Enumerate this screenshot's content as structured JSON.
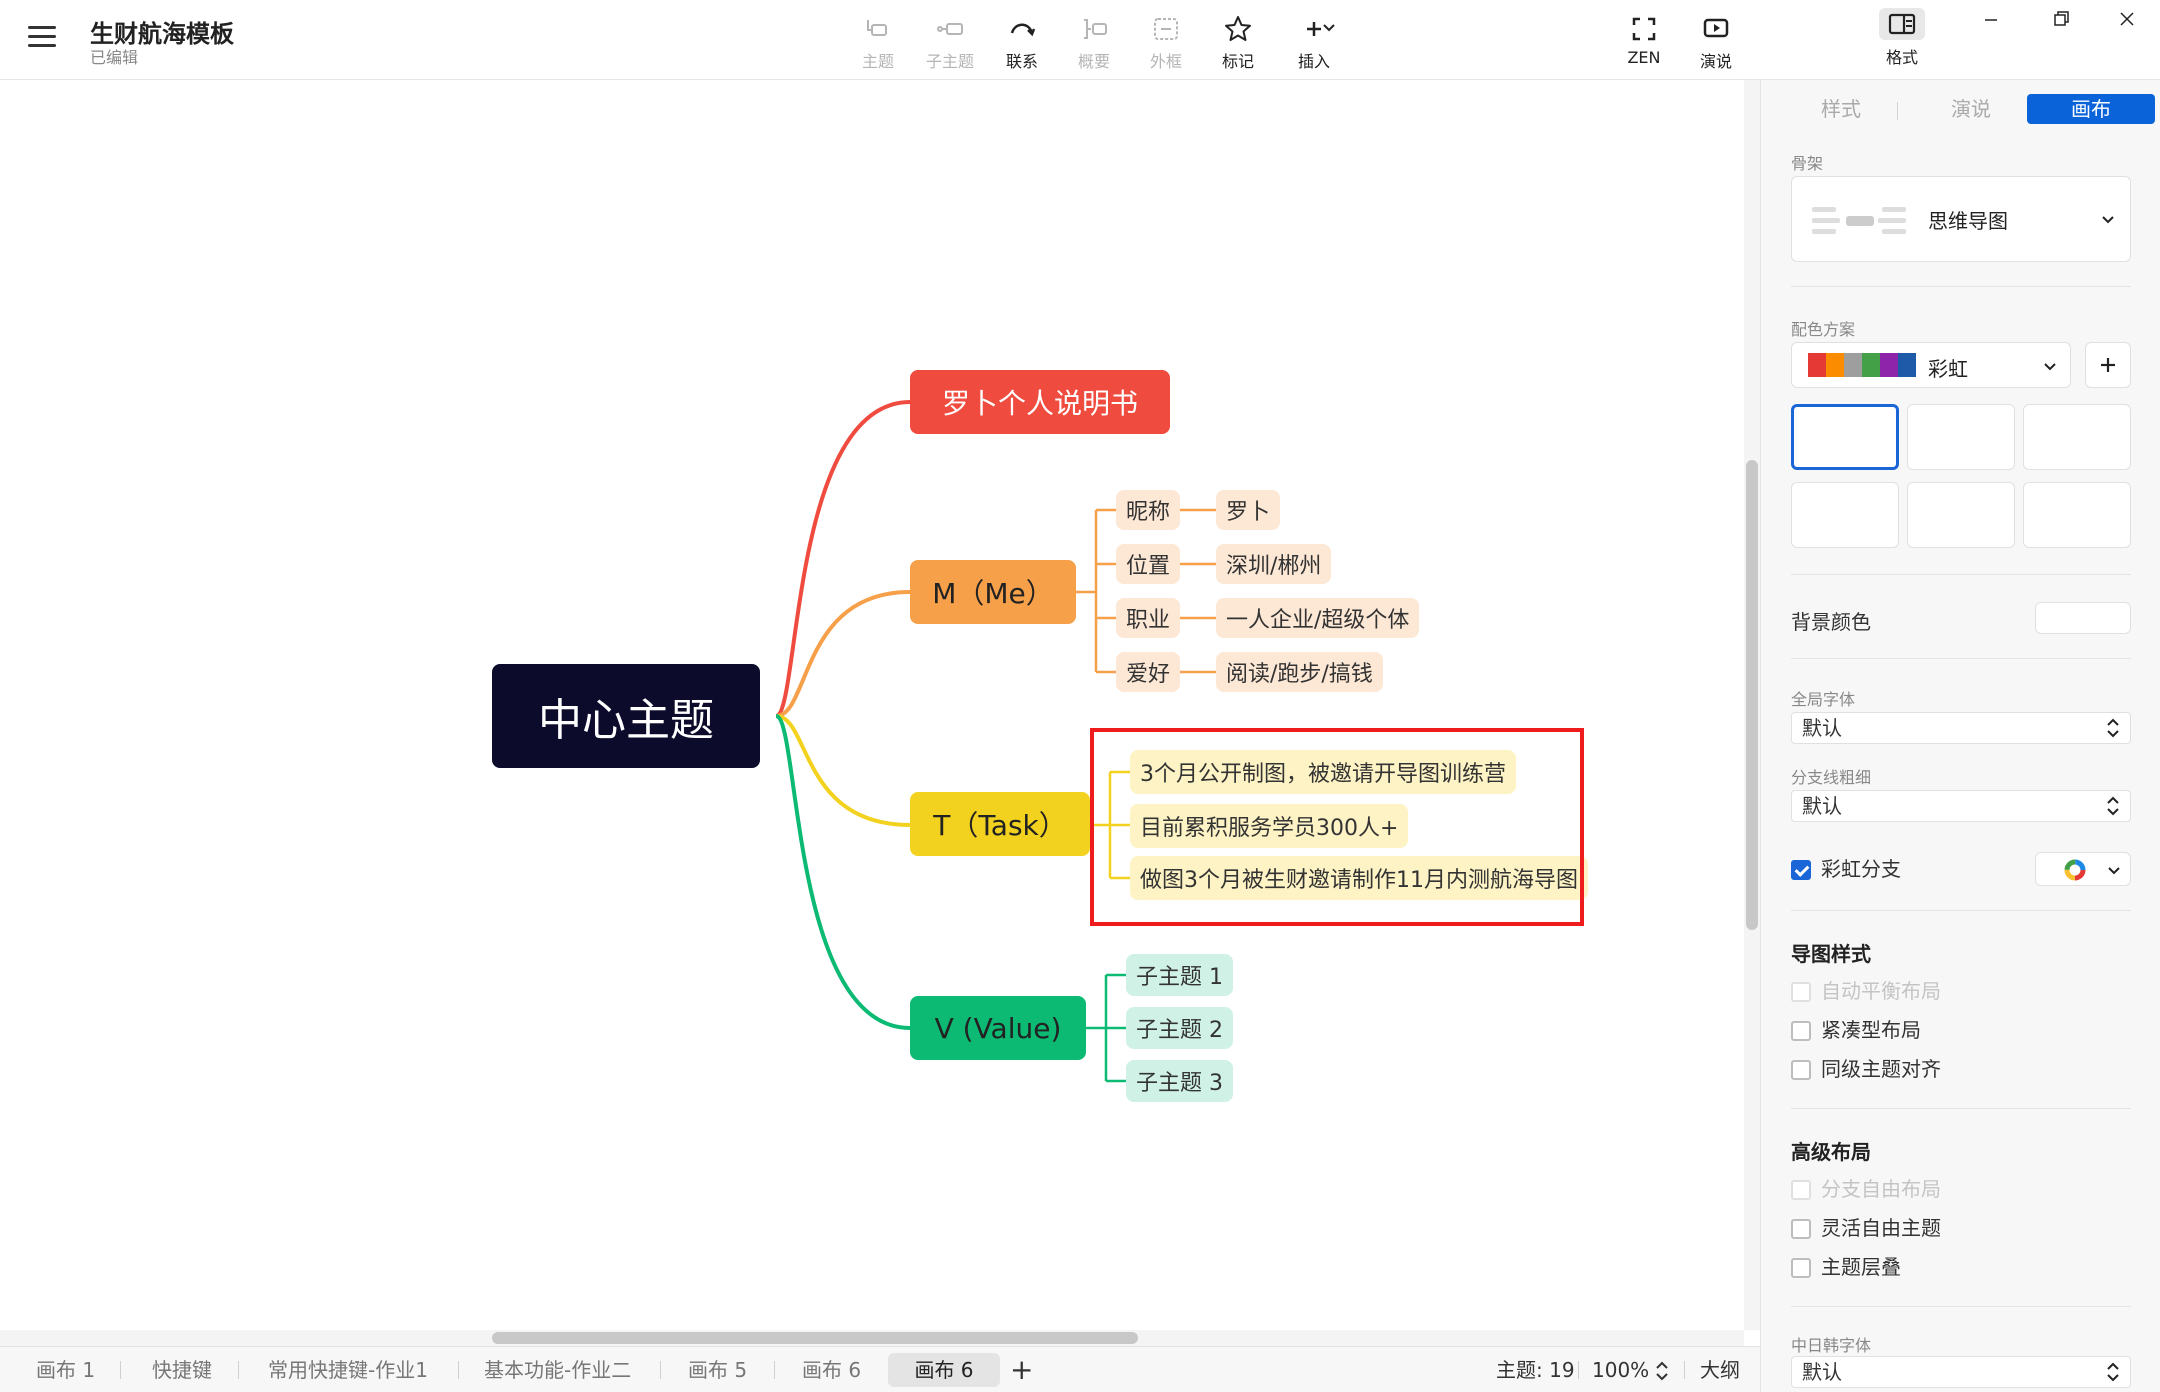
{
  "header": {
    "title": "生财航海模板",
    "status": "已编辑",
    "tools": [
      {
        "label": "主题",
        "icon": "topic-icon",
        "disabled": true
      },
      {
        "label": "子主题",
        "icon": "subtopic-icon",
        "disabled": true
      },
      {
        "label": "联系",
        "icon": "relationship-icon",
        "disabled": false
      },
      {
        "label": "概要",
        "icon": "summary-icon",
        "disabled": true
      },
      {
        "label": "外框",
        "icon": "boundary-icon",
        "disabled": true
      },
      {
        "label": "标记",
        "icon": "star-icon",
        "disabled": false
      },
      {
        "label": "插入",
        "icon": "plus-icon",
        "disabled": false
      }
    ],
    "right_tools": [
      {
        "label": "ZEN",
        "icon": "fullscreen-icon"
      },
      {
        "label": "演说",
        "icon": "present-icon"
      }
    ],
    "format_label": "格式"
  },
  "mindmap": {
    "central": "中心主题",
    "branches": [
      {
        "label": "罗卜个人说明书",
        "color": "#f04b3f",
        "children": []
      },
      {
        "label": "M（Me）",
        "color": "#f7a04a",
        "children": [
          {
            "label": "昵称",
            "value": "罗卜"
          },
          {
            "label": "位置",
            "value": "深圳/郴州"
          },
          {
            "label": "职业",
            "value": "一人企业/超级个体"
          },
          {
            "label": "爱好",
            "value": "阅读/跑步/搞钱"
          }
        ]
      },
      {
        "label": "T（Task）",
        "color": "#f2d21e",
        "children": [
          {
            "label": "3个月公开制图，被邀请开导图训练营"
          },
          {
            "label": "目前累积服务学员300人+"
          },
          {
            "label": "做图3个月被生财邀请制作11月内测航海导图"
          }
        ]
      },
      {
        "label": "V (Value)",
        "color": "#0cba74",
        "children": [
          {
            "label": "子主题 1"
          },
          {
            "label": "子主题 2"
          },
          {
            "label": "子主题 3"
          }
        ]
      }
    ],
    "highlight_color": "#ee1c1c"
  },
  "bottom": {
    "tabs": [
      "画布 1",
      "快捷键",
      "常用快捷键-作业1",
      "基本功能-作业二",
      "画布 5",
      "画布 6",
      "画布 6"
    ],
    "active_tab": 6,
    "topic_count": "主题: 19",
    "zoom": "100%",
    "outline": "大纲"
  },
  "panel": {
    "tabs": [
      "样式",
      "演说",
      "画布"
    ],
    "active_tab": 2,
    "skeleton_label": "骨架",
    "skeleton_value": "思维导图",
    "color_scheme_label": "配色方案",
    "color_scheme_value": "彩虹",
    "bg_color_label": "背景颜色",
    "global_font_label": "全局字体",
    "global_font_value": "默认",
    "branch_width_label": "分支线粗细",
    "branch_width_value": "默认",
    "rainbow_branch_label": "彩虹分支",
    "map_style_label": "导图样式",
    "map_style_options": [
      {
        "label": "自动平衡布局",
        "checked": false,
        "disabled": true
      },
      {
        "label": "紧凑型布局",
        "checked": false,
        "disabled": false
      },
      {
        "label": "同级主题对齐",
        "checked": false,
        "disabled": false
      }
    ],
    "advanced_label": "高级布局",
    "advanced_options": [
      {
        "label": "分支自由布局",
        "checked": false,
        "disabled": true
      },
      {
        "label": "灵活自由主题",
        "checked": false,
        "disabled": false
      },
      {
        "label": "主题层叠",
        "checked": false,
        "disabled": false
      }
    ],
    "cjk_font_label": "中日韩字体",
    "cjk_font_value": "默认"
  }
}
